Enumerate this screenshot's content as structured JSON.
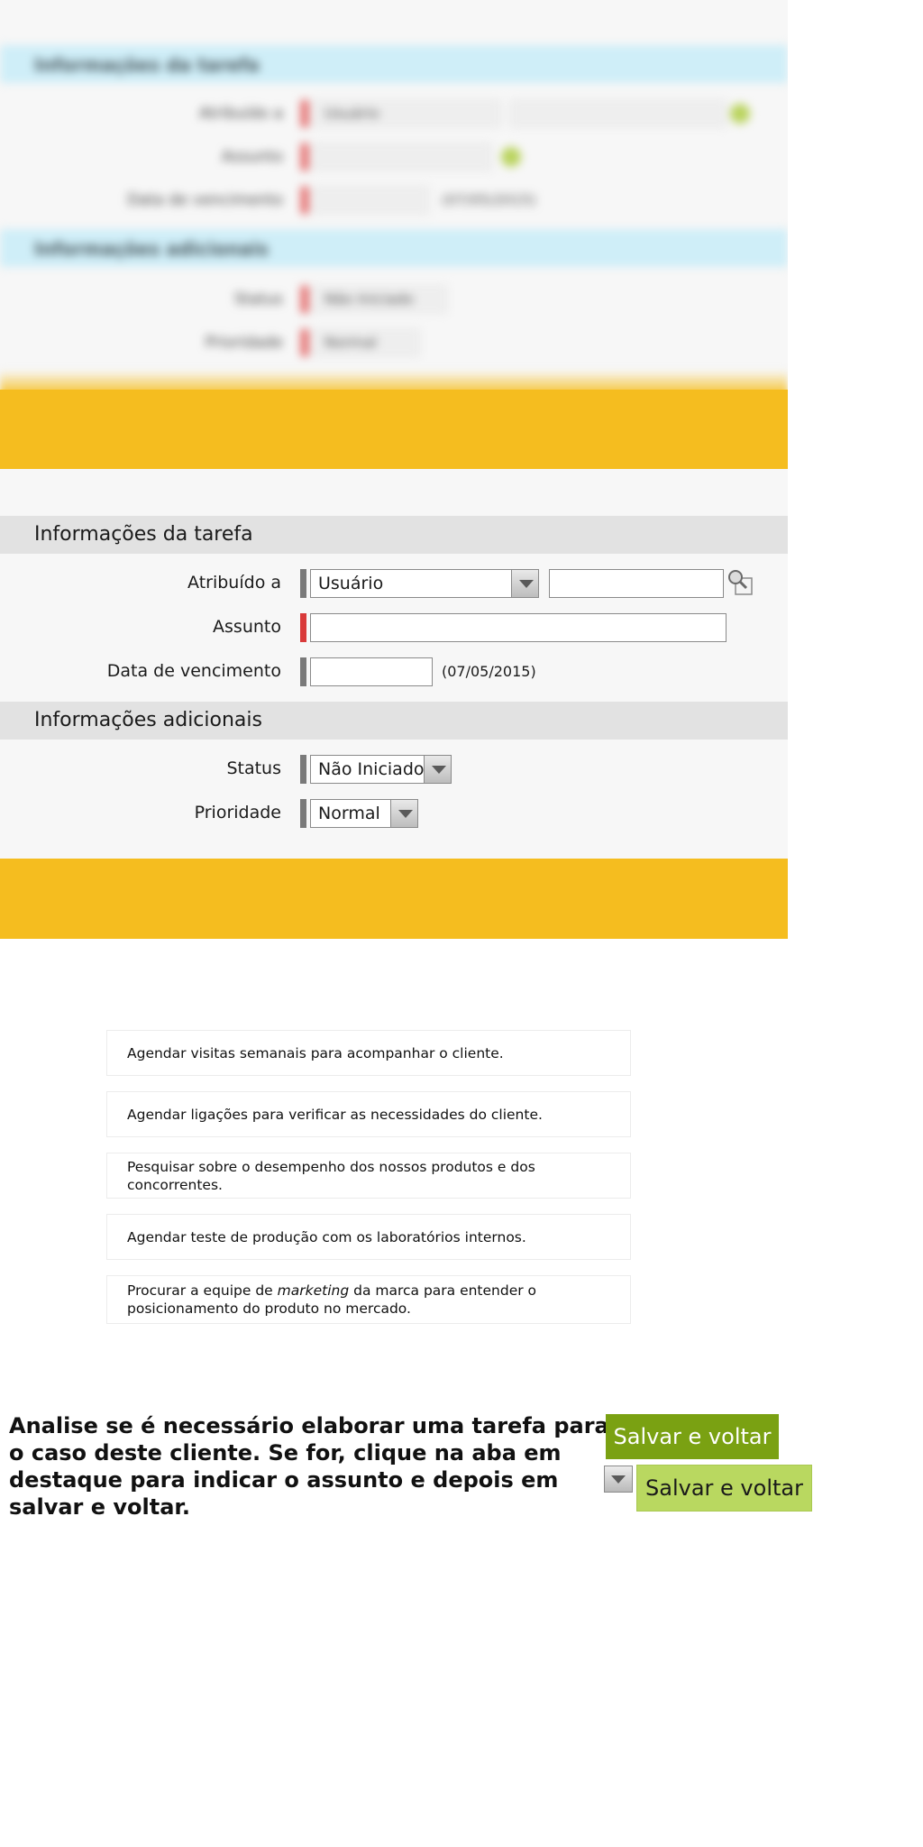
{
  "task_section": {
    "title": "Informações da tarefa"
  },
  "additional_section": {
    "title": "Informações adicionais"
  },
  "fields": {
    "assigned_to": {
      "label": "Atribuído a",
      "type_value": "Usuário",
      "value": ""
    },
    "subject": {
      "label": "Assunto",
      "value": ""
    },
    "due_date": {
      "label": "Data de vencimento",
      "value": "",
      "hint": "(07/05/2015)"
    },
    "status": {
      "label": "Status",
      "value": "Não Iniciado"
    },
    "priority": {
      "label": "Prioridade",
      "value": "Normal"
    }
  },
  "options": [
    {
      "text": "Agendar visitas semanais para acompanhar o cliente."
    },
    {
      "text": "Agendar ligações para verificar as necessidades do cliente."
    },
    {
      "text": "Pesquisar sobre o desempenho dos nossos produtos e dos concorrentes."
    },
    {
      "text": "Agendar teste de produção com os laboratórios internos."
    },
    {
      "text_before": "Procurar a equipe de ",
      "text_em": "marketing",
      "text_after": " da marca para entender o posicionamento do produto no mercado."
    }
  ],
  "instructions": "Analise se é necessário elaborar uma tarefa para o caso deste cliente. Se for, clique na aba em destaque para indicar o assunto e depois em salvar e voltar.",
  "buttons": {
    "save_back_primary": "Salvar e voltar",
    "save_back_secondary": "Salvar e voltar"
  },
  "colors": {
    "accent_yellow": "#f5bd1f",
    "button_dark_green": "#7aa112",
    "button_light_green": "#b9d860",
    "required_red": "#d93a3a"
  },
  "icons": {
    "lookup": "magnifier-icon",
    "dropdown": "chevron-down-icon"
  }
}
